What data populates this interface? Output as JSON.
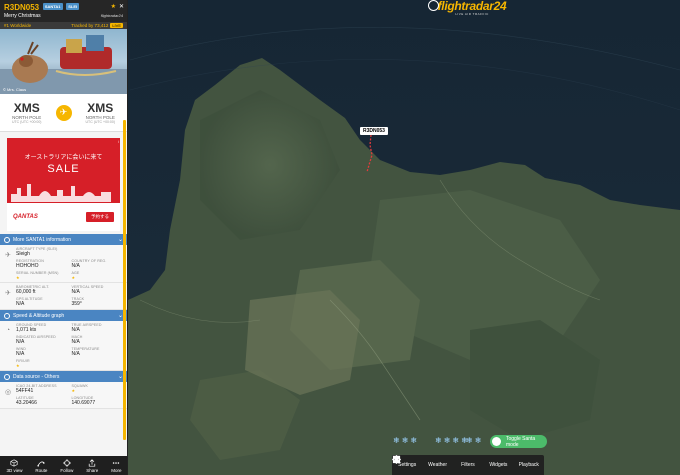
{
  "header": {
    "callsign": "R3DN053",
    "badges": [
      "SANTA1",
      "SLEI"
    ],
    "subtitle": "Merry Christmas",
    "logo_mini": "flightradar24"
  },
  "rank": {
    "worldwide": "#1 Worldwide",
    "tracked": "Tracked by 73,412",
    "live": "LIVE"
  },
  "photo": {
    "credit": "© Mrs. Claus"
  },
  "route": {
    "from_code": "XMS",
    "from_city": "NORTH POLE",
    "from_tz": "UTC (UTC +00:00)",
    "to_code": "XMS",
    "to_city": "NORTH POLE",
    "to_tz": "UTC (UTC +00:00)"
  },
  "ad": {
    "headline": "オーストラリアに会いに来て",
    "sale": "SALE",
    "brand": "QANTAS",
    "cta": "予約する",
    "tag": "i"
  },
  "sections": {
    "more": "More SANTA1 information",
    "speed": "Speed & Altitude graph",
    "data_source": "Data source - Others"
  },
  "aircraft": {
    "type_label": "AIRCRAFT TYPE (SLEI)",
    "type_value": "Sleigh",
    "reg_label": "REGISTRATION",
    "reg_value": "HOHOHO",
    "country_label": "COUNTRY OF REG.",
    "country_value": "N/A",
    "serial_label": "SERIAL NUMBER (MSN)",
    "age_label": "AGE"
  },
  "altitude": {
    "baro_label": "BAROMETRIC ALT.",
    "baro_value": "60,000 ft",
    "vs_label": "VERTICAL SPEED",
    "vs_value": "N/A",
    "gps_label": "GPS ALTITUDE",
    "gps_value": "N/A",
    "track_label": "TRACK",
    "track_value": "359°"
  },
  "speed": {
    "gs_label": "GROUND SPEED",
    "gs_value": "1,071 kts",
    "tas_label": "TRUE AIRSPEED",
    "tas_value": "N/A",
    "ias_label": "INDICATED AIRSPEED",
    "ias_value": "N/A",
    "mach_label": "MACH",
    "mach_value": "N/A",
    "wind_label": "WIND",
    "wind_value": "N/A",
    "temp_label": "TEMPERATURE",
    "temp_value": "N/A",
    "fir_label": "FIR/UIR"
  },
  "source": {
    "icao_label": "ICAO 24-BIT ADDRESS",
    "icao_value": "54FF41",
    "squawk_label": "SQUAWK",
    "lat_label": "LATITUDE",
    "lat_value": "43.20466",
    "lon_label": "LONGITUDE",
    "lon_value": "140.69077"
  },
  "bottom_nav": [
    "3D view",
    "Route",
    "Follow",
    "Share",
    "More"
  ],
  "map": {
    "logo": "flightradar24",
    "logo_sub": "LIVE AIR TRAFFIC",
    "callsign_tag": "R3DN053",
    "toggle_label": "Toggle Santa mode",
    "toolbar": [
      "Settings",
      "Weather",
      "Filters",
      "Widgets",
      "Playback"
    ]
  },
  "colors": {
    "accent": "#f6b600",
    "section": "#4a85c2",
    "ad": "#d61f28"
  }
}
